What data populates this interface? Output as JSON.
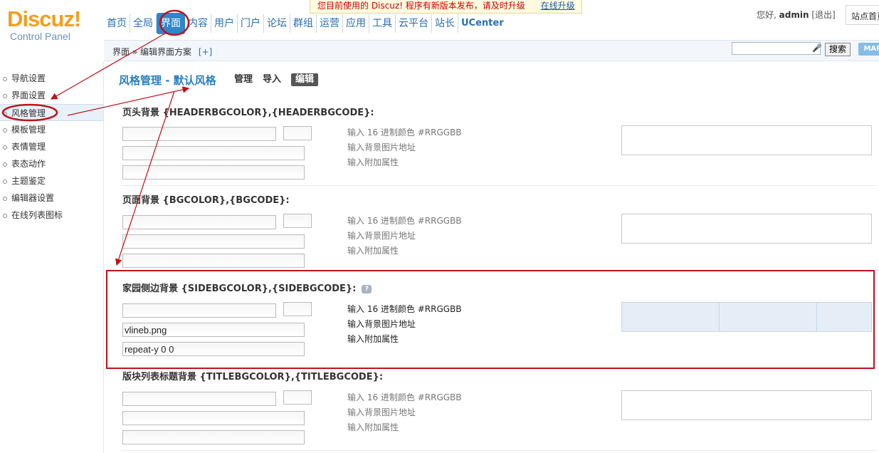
{
  "logo": {
    "title": "Discuz!",
    "subtitle": "Control Panel"
  },
  "notice": {
    "text": "您目前使用的 Discuz! 程序有新版本发布，请及时升级",
    "link": "在线升级"
  },
  "nav": [
    "首页",
    "全局",
    "界面",
    "内容",
    "用户",
    "门户",
    "论坛",
    "群组",
    "运营",
    "应用",
    "工具",
    "云平台",
    "站长",
    "UCenter"
  ],
  "user": {
    "greeting": "您好,",
    "name": "admin",
    "logout": "[退出]",
    "site_index": "站点首页"
  },
  "breadcrumb": {
    "path": "界面 » 编辑界面方案",
    "plus": "[+]"
  },
  "search": {
    "value": "",
    "button": "搜索",
    "map": "MAP"
  },
  "sidebar": {
    "items": [
      {
        "label": "导航设置"
      },
      {
        "label": "界面设置"
      },
      {
        "label": "风格管理"
      },
      {
        "label": "模板管理"
      },
      {
        "label": "表情管理"
      },
      {
        "label": "表态动作"
      },
      {
        "label": "主题鉴定"
      },
      {
        "label": "编辑器设置"
      },
      {
        "label": "在线列表图标"
      }
    ]
  },
  "page": {
    "title": "风格管理 - 默认风格",
    "tabs": [
      "管理",
      "导入",
      "编辑"
    ]
  },
  "hints": {
    "color": "输入 16 进制颜色 #RRGGBB",
    "image": "输入背景图片地址",
    "extra": "输入附加属性"
  },
  "sections": [
    {
      "title": "页头背景 {HEADERBGCOLOR},{HEADERBGCODE}:",
      "image": "",
      "extra": ""
    },
    {
      "title": "页面背景 {BGCOLOR},{BGCODE}:",
      "image": "",
      "extra": ""
    },
    {
      "title": "家园侧边背景 {SIDEBGCOLOR},{SIDEBGCODE}:",
      "image": "vlineb.png",
      "extra": "repeat-y 0 0"
    },
    {
      "title": "版块列表标题背景 {TITLEBGCOLOR},{TITLEBGCODE}:",
      "image": "",
      "extra": ""
    }
  ],
  "colors": {
    "brand": "#F29F1E",
    "link": "#2a6fae",
    "annotation": "#c0121c"
  }
}
